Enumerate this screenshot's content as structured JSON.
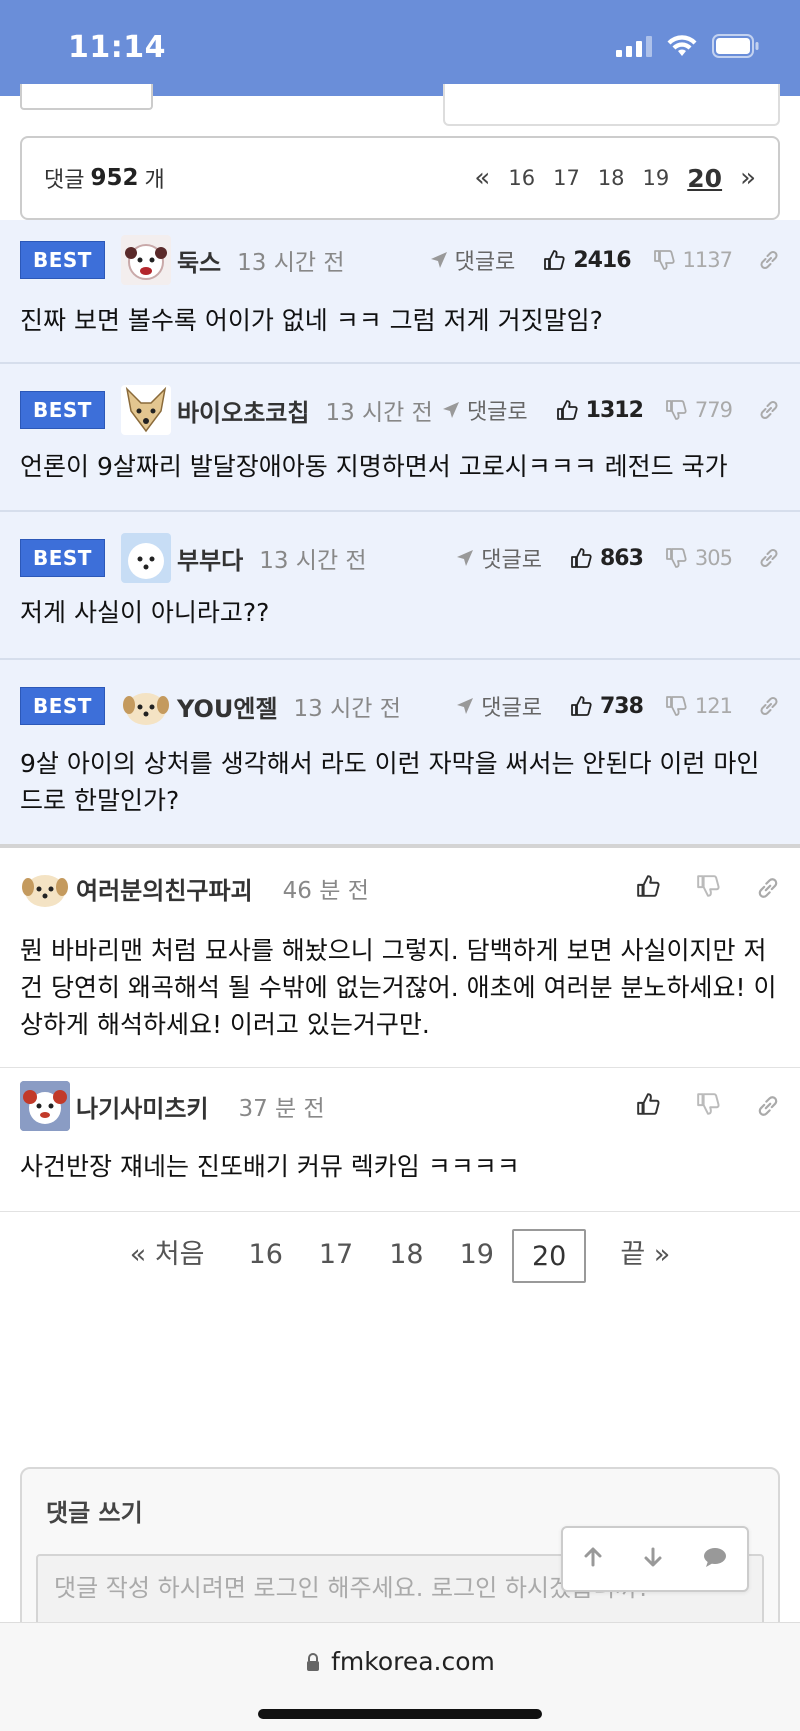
{
  "status_bar": {
    "time": "11:14"
  },
  "comment_header": {
    "label": "댓글",
    "count": "952",
    "unit": "개",
    "pager": {
      "prev": "«",
      "pages": [
        "16",
        "17",
        "18",
        "19"
      ],
      "current": "20",
      "next": "»"
    }
  },
  "best_badge": "BEST",
  "reply_label": "댓글로",
  "best_comments": [
    {
      "nick": "둑스",
      "time": "13 시간 전",
      "likes": "2416",
      "dislikes": "1137",
      "text": "진짜 보면 볼수록 어이가 없네 ㅋㅋ 그럼 저게 거짓말임?"
    },
    {
      "nick": "바이오초코칩",
      "time": "13 시간 전",
      "likes": "1312",
      "dislikes": "779",
      "text": "언론이 9살짜리 발달장애아동 지명하면서 고로시ㅋㅋㅋ 레전드 국가"
    },
    {
      "nick": "부부다",
      "time": "13 시간 전",
      "likes": "863",
      "dislikes": "305",
      "text": "저게 사실이 아니라고??"
    },
    {
      "nick": "YOU엔젤",
      "time": "13 시간 전",
      "likes": "738",
      "dislikes": "121",
      "text": "9살 아이의 상처를 생각해서 라도 이런 자막을 써서는 안된다 이런 마인드로 한말인가?"
    }
  ],
  "comments": [
    {
      "nick": "여러분의친구파괴",
      "time": "46 분 전",
      "text": "뭔 바바리맨 처럼 묘사를 해놨으니 그렇지. 담백하게 보면 사실이지만 저건 당연히 왜곡해석 될 수밖에 없는거잖어. 애초에 여러분 분노하세요! 이상하게 해석하세요! 이러고 있는거구만."
    },
    {
      "nick": "나기사미츠키",
      "time": "37 분 전",
      "text": "사건반장 쟤네는 진또배기 커뮤 렉카임 ㅋㅋㅋㅋ"
    }
  ],
  "bottom_pager": {
    "first": "« 처음",
    "pages": [
      "16",
      "17",
      "18",
      "19"
    ],
    "current": "20",
    "last": "끝 »"
  },
  "write": {
    "title": "댓글 쓰기",
    "placeholder": "댓글 작성 하시려면 로그인 해주세요. 로그인 하시겠습니까?"
  },
  "browser": {
    "url": "fmkorea.com"
  },
  "colors": {
    "status_bar": "#6a8ed9",
    "best_bg": "#edf2fc",
    "badge": "#3d6fd9"
  }
}
